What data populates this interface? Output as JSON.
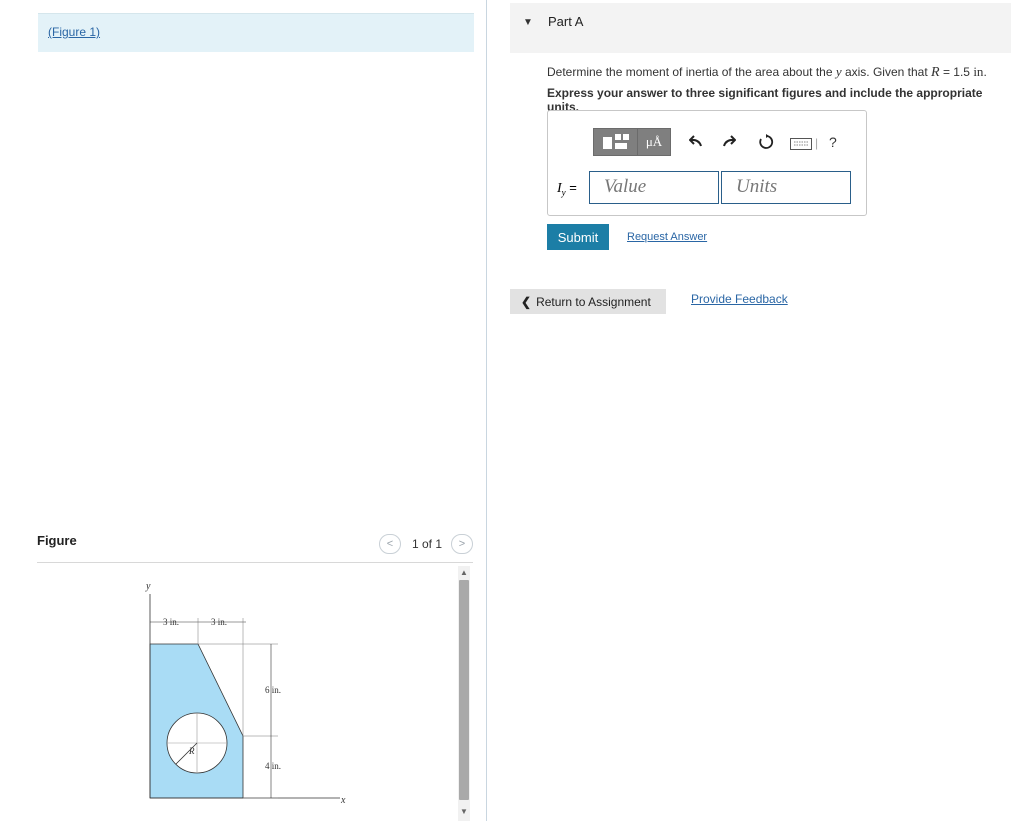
{
  "left_pane": {
    "figure_link": "(Figure 1)",
    "figure_heading": "Figure",
    "pager": {
      "text": "1 of 1",
      "prev": "<",
      "next": ">"
    },
    "figure": {
      "y_axis": "y",
      "x_axis": "x",
      "dim_left": "3 in.",
      "dim_right": "3 in.",
      "dim_upper": "6 in.",
      "dim_lower": "4 in.",
      "radius": "R",
      "fill_color": "#a9dcf5"
    }
  },
  "part": {
    "title": "Part A",
    "question_pre": "Determine the moment of inertia of the area about the",
    "axis_var": "y",
    "question_mid": "axis. Given that",
    "r_var": "R",
    "equals": "= 1.5",
    "unit": "in",
    "period": ".",
    "instruction": "Express your answer to three significant figures and include the appropriate units.",
    "answer_label": "I",
    "answer_sub": "y",
    "answer_eq": "=",
    "value_placeholder": "Value",
    "units_placeholder": "Units",
    "toolbar": {
      "units_button": "μÅ",
      "help": "?"
    }
  },
  "actions": {
    "submit": "Submit",
    "request_answer": "Request Answer",
    "return": "Return to Assignment",
    "feedback": "Provide Feedback"
  }
}
